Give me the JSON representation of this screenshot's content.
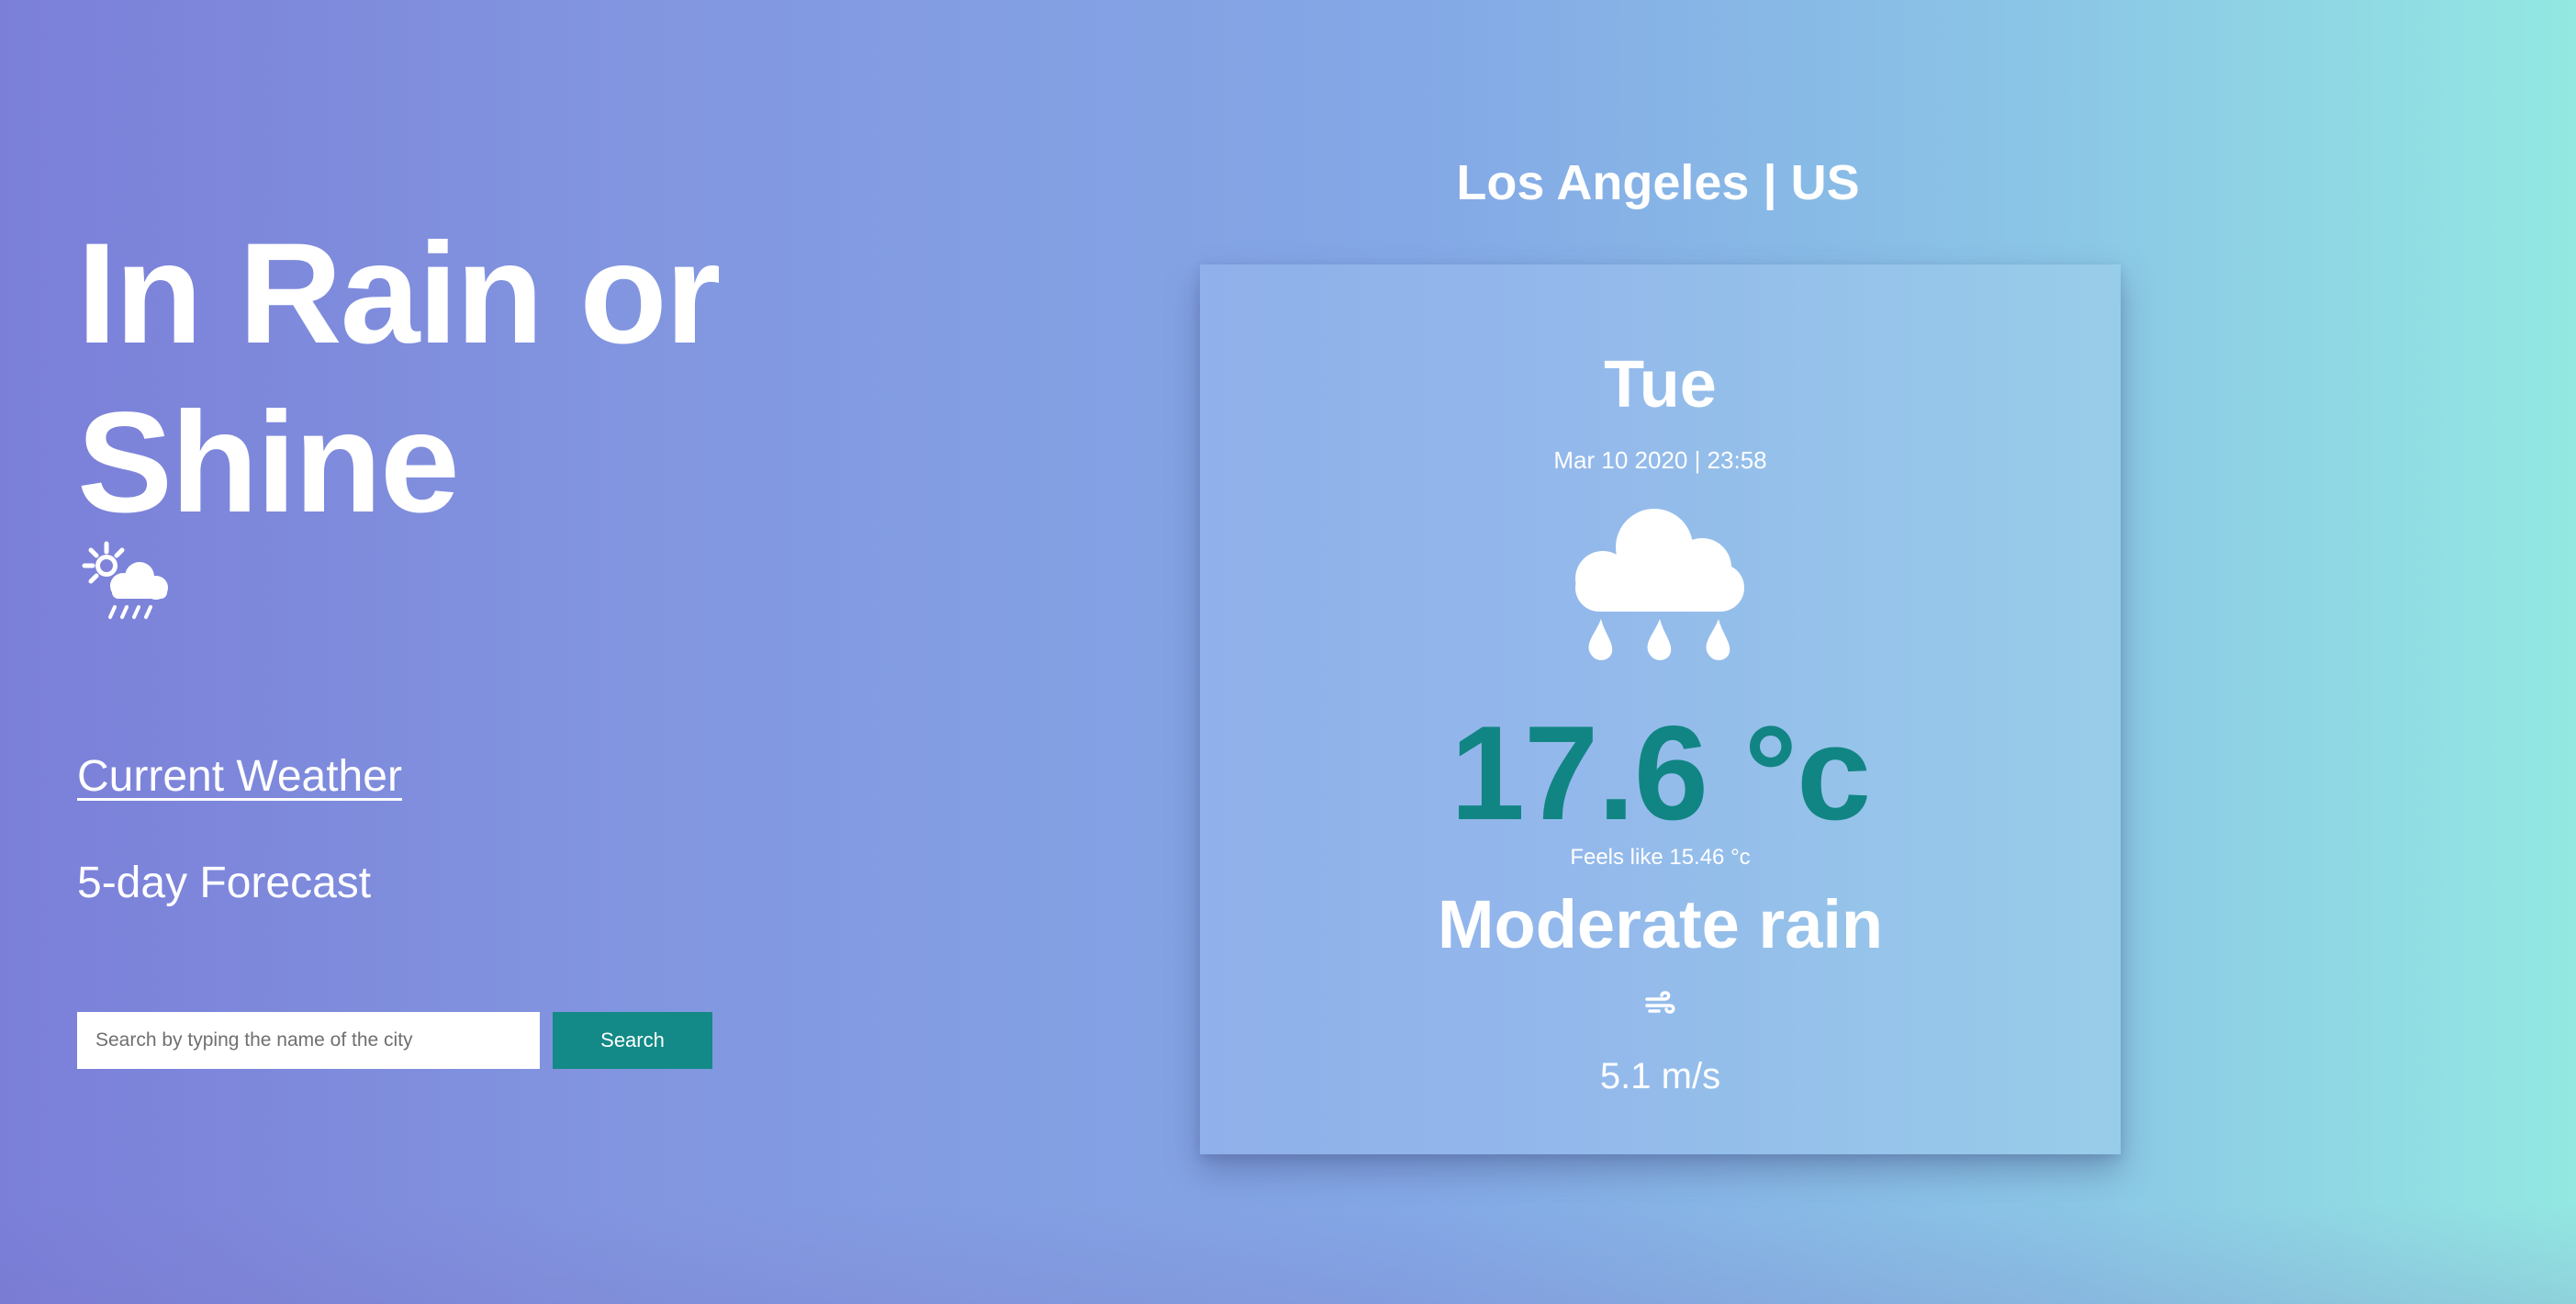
{
  "hero": {
    "title": "In Rain or Shine",
    "icon": "sun-cloud-rain-icon"
  },
  "nav": {
    "current_weather": "Current Weather",
    "forecast": "5-day Forecast"
  },
  "search": {
    "placeholder": "Search by typing the name of the city",
    "value": "",
    "button_label": "Search"
  },
  "weather": {
    "location": "Los Angeles | US",
    "day": "Tue",
    "datetime": "Mar 10 2020 | 23:58",
    "icon": "cloud-rain-icon",
    "temperature": "17.6 °c",
    "feels_like": "Feels like 15.46 °c",
    "description": "Moderate rain",
    "wind_icon": "wind-icon",
    "wind_speed": "5.1 m/s"
  },
  "colors": {
    "accent": "#138a87",
    "temperature": "#118583",
    "gradient_start": "#7b7fd8",
    "gradient_end": "#93e8e2"
  }
}
